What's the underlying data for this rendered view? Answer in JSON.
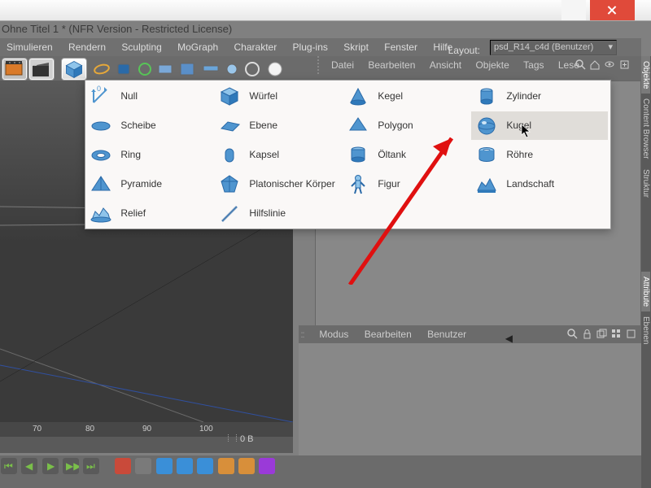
{
  "title": "Ohne Titel 1 * (NFR Version - Restricted License)",
  "menu": [
    "Simulieren",
    "Rendern",
    "Sculpting",
    "MoGraph",
    "Charakter",
    "Plug-ins",
    "Skript",
    "Fenster",
    "Hilfe"
  ],
  "layout_label": "Layout:",
  "layout_value": "psd_R14_c4d (Benutzer)",
  "obj_menu": [
    "Datei",
    "Bearbeiten",
    "Ansicht",
    "Objekte",
    "Tags",
    "Lese"
  ],
  "attr_menu": [
    "Modus",
    "Bearbeiten",
    "Benutzer"
  ],
  "ruler": [
    {
      "p": 40,
      "v": "70"
    },
    {
      "p": 105,
      "v": "80"
    },
    {
      "p": 175,
      "v": "90"
    },
    {
      "p": 245,
      "v": "100"
    }
  ],
  "bytes": "0 B",
  "sidetabs": [
    "Objekte",
    "Content Browser",
    "Struktur"
  ],
  "sidetabs2": [
    "Attribute",
    "Ebenen"
  ],
  "flyout": {
    "c1": [
      {
        "k": "null",
        "l": "Null"
      },
      {
        "k": "scheibe",
        "l": "Scheibe"
      },
      {
        "k": "ring",
        "l": "Ring"
      },
      {
        "k": "pyramide",
        "l": "Pyramide"
      },
      {
        "k": "relief",
        "l": "Relief"
      }
    ],
    "c2": [
      {
        "k": "wurfel",
        "l": "Würfel"
      },
      {
        "k": "ebene",
        "l": "Ebene"
      },
      {
        "k": "kapsel",
        "l": "Kapsel"
      },
      {
        "k": "platon",
        "l": "Platonischer Körper"
      },
      {
        "k": "hilfslinie",
        "l": "Hilfslinie"
      }
    ],
    "c3": [
      {
        "k": "kegel",
        "l": "Kegel"
      },
      {
        "k": "polygon",
        "l": "Polygon"
      },
      {
        "k": "oltank",
        "l": "Öltank"
      },
      {
        "k": "figur",
        "l": "Figur"
      }
    ],
    "c4": [
      {
        "k": "zylinder",
        "l": "Zylinder"
      },
      {
        "k": "kugel",
        "l": "Kugel"
      },
      {
        "k": "rohre",
        "l": "Röhre"
      },
      {
        "k": "landschaft",
        "l": "Landschaft"
      }
    ]
  },
  "chart_data": null
}
